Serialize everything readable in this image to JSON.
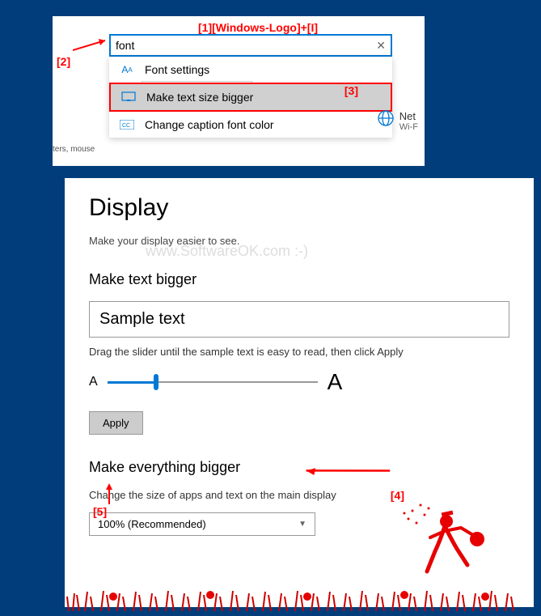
{
  "watermark": "www.SoftwareOK.com :-)",
  "annotations": {
    "a1": "[1][Windows-Logo]+[I]",
    "a2": "[2]",
    "a3": "[3]",
    "a4": "[4]",
    "a5": "[5]"
  },
  "search": {
    "value": "font",
    "clear": "✕",
    "tooltip": "Make text size bigger",
    "items": [
      "Font settings",
      "Make text size bigger",
      "Change caption font color"
    ]
  },
  "side": {
    "left": "ters, mouse",
    "net": "Net",
    "wifi": "Wi-F"
  },
  "display": {
    "title": "Display",
    "subtitle": "Make your display easier to see.",
    "section1": "Make text bigger",
    "sample": "Sample text",
    "instruction": "Drag the slider until the sample text is easy to read, then click Apply",
    "smallA": "A",
    "bigA": "A",
    "apply": "Apply",
    "section2": "Make everything bigger",
    "desc2": "Change the size of apps and text on the main display",
    "scale": "100% (Recommended)"
  }
}
